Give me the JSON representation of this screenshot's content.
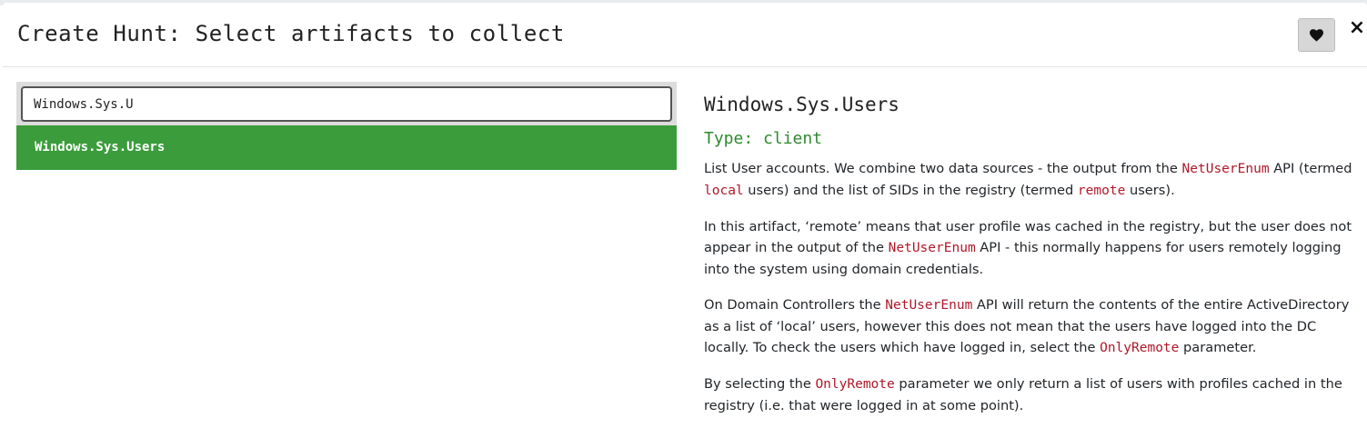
{
  "modal": {
    "title": "Create Hunt: Select artifacts to collect",
    "close_label": "×"
  },
  "search": {
    "value": "Windows.Sys.U"
  },
  "results": [
    {
      "label": "Windows.Sys.Users"
    }
  ],
  "artifact": {
    "name": "Windows.Sys.Users",
    "type_line": "Type: client",
    "p1": {
      "t1": "List User accounts. We combine two data sources - the output from the ",
      "c1": "NetUserEnum",
      "t2": " API (termed ",
      "c2": "local",
      "t3": " users) and the list of SIDs in the registry (termed ",
      "c3": "remote",
      "t4": " users)."
    },
    "p2": {
      "t1": "In this artifact, ‘remote’ means that user profile was cached in the registry, but the user does not appear in the output of the ",
      "c1": "NetUserEnum",
      "t2": " API - this normally happens for users remotely logging into the system using domain credentials."
    },
    "p3": {
      "t1": "On Domain Controllers the ",
      "c1": "NetUserEnum",
      "t2": " API will return the contents of the entire ActiveDirectory as a list of ‘local’ users, however this does not mean that the users have logged into the DC locally. To check the users which have logged in, select the ",
      "c2": "OnlyRemote",
      "t3": " parameter."
    },
    "p4": {
      "t1": "By selecting the ",
      "c1": "OnlyRemote",
      "t2": " parameter we only return a list of users with profiles cached in the registry (i.e. that were logged in at some point)."
    }
  },
  "icons": {
    "favorite": "heart-icon",
    "close": "close-icon"
  },
  "colors": {
    "selected_bg": "#3a9c3a",
    "type_text": "#2e8b2e",
    "code_text": "#b0182a"
  }
}
